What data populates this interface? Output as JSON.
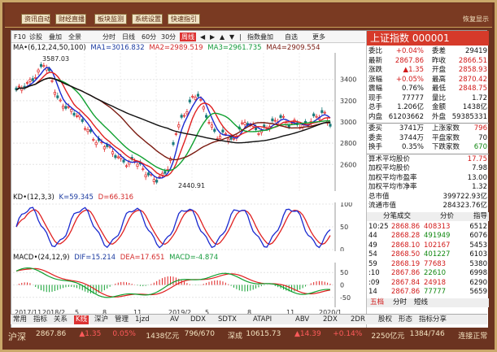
{
  "toolbar_top": [
    "资讯自动",
    "财经直播",
    "板块监测",
    "系统设置",
    "快速指引"
  ],
  "top_right": "恢复显示",
  "chart_toolbar": {
    "items": [
      "F10",
      "诊股",
      "叠加",
      "全景",
      "分时",
      "日线",
      "60分",
      "30分",
      "周线",
      "◀",
      "▶",
      "▲",
      "▼",
      "|",
      "指数叠加",
      "自选",
      "更多"
    ],
    "active": "周线"
  },
  "ma_legend": {
    "main": "MA•(6,12,24,50,100)",
    "ma1": "MA1=3016.832",
    "ma2": "MA2=2989.519",
    "ma3": "MA3=2961.735",
    "ma4": "MA4=2909.554",
    "high_label": "3587.03",
    "low_label": "2440.91"
  },
  "price_axis": [
    "3400",
    "3200",
    "3000",
    "2800",
    "2600"
  ],
  "kd_legend": {
    "main": "KD•(12,3,3)",
    "k": "K=59.345",
    "d": "D=66.316"
  },
  "kd_axis": [
    "100",
    "50",
    "0"
  ],
  "macd_legend": {
    "main": "MACD•(24,12,9)",
    "dif": "DIF=15.214",
    "dea": "DEA=17.651",
    "macd": "MACD=-4.874"
  },
  "macd_axis": [
    "50",
    "0",
    "-50"
  ],
  "x_axis": [
    "2017/11",
    "2018/2",
    "5",
    "8",
    "11",
    "2019/2",
    "5",
    "8",
    "11",
    "2020/1"
  ],
  "quote": {
    "title": "上证指数 000001",
    "rows": [
      [
        "委比",
        "+0.04%",
        "委差",
        "29419"
      ],
      [
        "最新",
        "2867.86",
        "昨收",
        "2866.51"
      ],
      [
        "涨跌",
        "▲1.35",
        "开盘",
        "2858.93"
      ],
      [
        "涨幅",
        "+0.05%",
        "最高",
        "2870.42"
      ],
      [
        "震幅",
        "0.76%",
        "最低",
        "2848.75"
      ],
      [
        "现手",
        "77777",
        "量比",
        "1.72"
      ],
      [
        "总手",
        "1.206亿",
        "金额",
        "1438亿"
      ],
      [
        "内盘",
        "61203662",
        "外盘",
        "59385331"
      ]
    ],
    "rows2": [
      [
        "委买",
        "3741万",
        "上涨家数",
        "796"
      ],
      [
        "委卖",
        "3744万",
        "平盘家数",
        "70"
      ],
      [
        "换手",
        "0.35%",
        "下跌家数",
        "670"
      ]
    ],
    "rows3": [
      [
        "算术平均股价",
        "17.75"
      ],
      [
        "加权平均股价",
        "7.98"
      ],
      [
        "加权平均市盈率",
        "13.00"
      ],
      [
        "加权平均市净率",
        "1.32"
      ],
      [
        "总市值",
        "399722.93亿"
      ],
      [
        "流通市值",
        "284323.76亿"
      ]
    ],
    "tabs": [
      "分笔成交",
      "分价",
      "指导"
    ],
    "ticks": [
      [
        "10:25",
        "2868.86",
        "408313",
        "6512"
      ],
      [
        "44",
        "2868.28",
        "491949",
        "6076"
      ],
      [
        "49",
        "2868.10",
        "102167",
        "5453"
      ],
      [
        "54",
        "2868.50",
        "401227",
        "6103"
      ],
      [
        "59",
        "2868.19",
        "77683",
        "5380"
      ],
      [
        ":10",
        "2867.86",
        "22610",
        "6998"
      ],
      [
        ":09",
        "2867.84",
        "24918",
        "6290"
      ],
      [
        "14",
        "2867.86",
        "77777",
        "5659"
      ]
    ],
    "bottom_tabs": [
      "五档",
      "分时",
      "短线"
    ]
  },
  "bottom_tabs": [
    "常用",
    "指标",
    "关系",
    "K线",
    "深沪",
    "管理",
    "1jzd",
    "AV",
    "DDX",
    "SDTX",
    "ATAPI",
    "ABV",
    "2DX",
    "2DR",
    "股权",
    "形态",
    "指标分享"
  ],
  "bottom_active": "K线",
  "status": {
    "label": "沪深",
    "items": [
      {
        "t": "2867.86",
        "c": "#f3e3c0"
      },
      {
        "t": "▲1.35",
        "c": "#ff5a5a"
      },
      {
        "t": "0.05%",
        "c": "#ff5a5a"
      },
      {
        "t": "1438亿元",
        "c": "#f3e3c0"
      },
      {
        "t": "796/670",
        "c": "#f3e3c0"
      },
      {
        "t": "深成",
        "c": "#f3e3c0"
      },
      {
        "t": "10615.73",
        "c": "#f3e3c0"
      },
      {
        "t": "▲14.39",
        "c": "#ff5a5a"
      },
      {
        "t": "+0.14%",
        "c": "#ff5a5a"
      },
      {
        "t": "2250亿元",
        "c": "#f3e3c0"
      },
      {
        "t": "1384/746",
        "c": "#f3e3c0"
      },
      {
        "t": "连接正常",
        "c": "#f3e3c0"
      }
    ]
  }
}
